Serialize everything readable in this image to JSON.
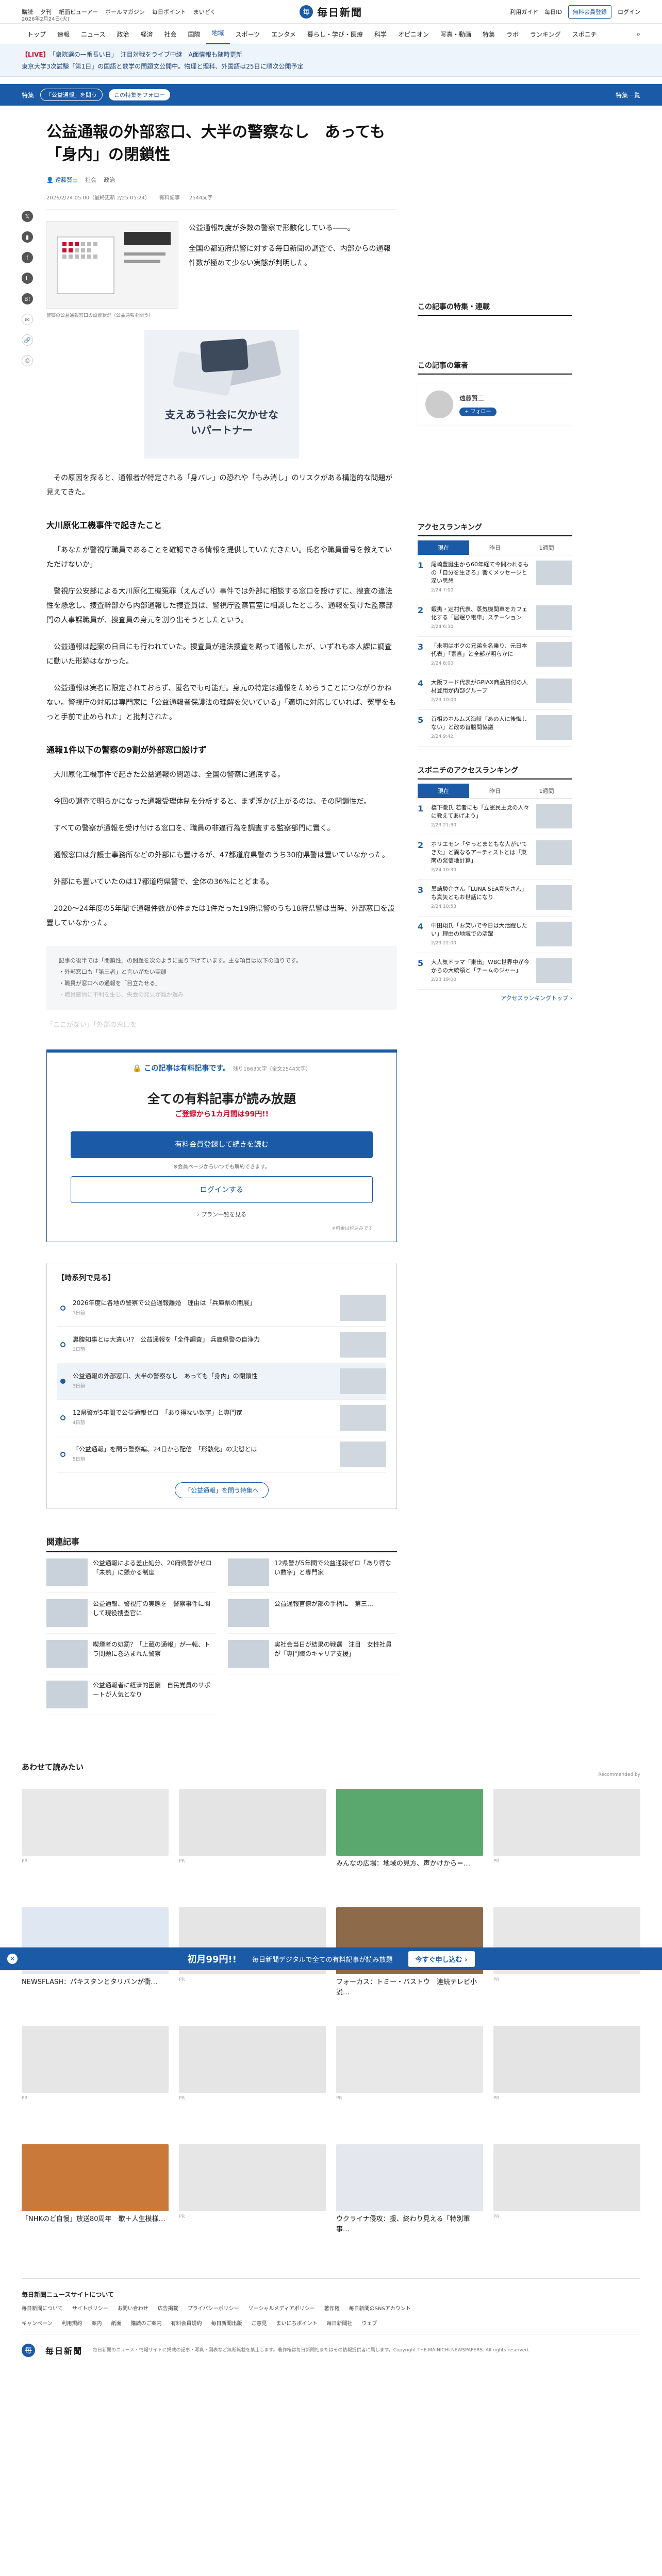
{
  "util": {
    "links": [
      "購読",
      "夕刊",
      "紙面ビューアー",
      "ポールマガジン",
      "毎日ポイント",
      "まいどく"
    ],
    "date": "2026年2月24日(火)",
    "right": [
      "利用ガイド",
      "毎日ID",
      "ログイン"
    ],
    "register": "無料会員登録",
    "login": "ログイン"
  },
  "logo": {
    "text": "毎日新聞"
  },
  "gnav": [
    "トップ",
    "速報",
    "ニュース",
    "政治",
    "経済",
    "社会",
    "国際",
    "地域",
    "スポーツ",
    "エンタメ",
    "暮らし・学び・医療",
    "科学",
    "オピニオン",
    "写真・動画",
    "特集",
    "ラボ",
    "ランキング",
    "スポニチ"
  ],
  "breaking": [
    {
      "tag": "【LIVE】",
      "text": "「衆院選の一番長い日」　注目対戦をライブ中継　A面情報も随時更新"
    },
    {
      "tag": "",
      "text": "東京大学3次試験「第1日」の国語と数学の問題文公開中。物理と理科、外国語は25日に順次公開予定"
    }
  ],
  "theme": {
    "label": "特集",
    "name": "「公益通報」を問う",
    "follow": "この特集をフォロー",
    "right": "特集一覧"
  },
  "article": {
    "title": "公益通報の外部窓口、大半の警察なし　あっても「身内」の閉鎖性",
    "author": "遠藤賢三",
    "tags": [
      "社会",
      "政治"
    ],
    "date": "2026/2/24 05:00（最終更新 2/25 05:24）",
    "paid": "有料記事",
    "chars": "2544文字",
    "fig1_caption": "警察の公益通報窓口の設置状況（公益通報を問う）",
    "lead": [
      "公益通報制度が多数の警察で形骸化している――。",
      "全国の都道府県警に対する毎日新聞の調査で、内部からの通報件数が極めて少ない実態が判明した。"
    ],
    "fig2_text": "支えあう社会に欠かせないパートナー",
    "paras": [
      "その原因を探ると、通報者が特定される「身バレ」の恐れや「もみ消し」のリスクがある構造的な問題が見えてきた。",
      "「あなたが警視庁職員であることを確認できる情報を提供していただきたい。氏名や職員番号を教えていただけないか」",
      "警視庁公安部による大川原化工機冤罪（えんざい）事件では外部に相談する窓口を設けずに、捜査の違法性を懸念し、捜査幹部から内部通報した捜査員は、警視庁監察官室に相談したところ、通報を受けた監察部門の人事課職員が、捜査員の身元を割り出そうとしたという。",
      "公益通報は起案の日目にも行われていた。捜査員が違法捜査を黙って通報したが、いずれも本人課に調査に動いた形跡はなかった。",
      "公益通報は実名に限定されておらず、匿名でも可能だ。身元の特定は通報をためらうことにつながりかねない。警視庁の対応は専門家に「公益通報者保護法の理解を欠いている」「適切に対応していれば、冤罪をもっと手前で止められた」と批判された。",
      "大川原化工機事件で起きた公益通報の問題は、全国の警察に通底する。",
      "今回の調査で明らかになった通報受理体制を分析すると、まず浮かび上がるのは、その閉鎖性だ。",
      "すべての警察が通報を受け付ける窓口を、職員の非違行為を調査する監察部門に置く。",
      "通報窓口は弁護士事務所などの外部にも置けるが、47都道府県警のうち30府県警は置いていなかった。",
      "外部にも置いていたのは17都道府県警で、全体の36%にとどまる。",
      "2020〜24年度の5年間で通報件数が0件または1件だった19府県警のうち18府県警は当時、外部窓口を設置していなかった。"
    ],
    "h2_1": "大川原化工機事件で起きたこと",
    "h2_2": "通報1件以下の警察の9割が外部窓口設けず",
    "notice": [
      "記事の後半では「閉鎖性」の問題を次のように掘り下げています。主な項目は以下の通りです。",
      "・外部窓口も「第三者」と言いがたい実態",
      "・職員が窓口への通報を「目立たせる」",
      "・職員感情に不利を生じ、失会の発見が難か遅み"
    ],
    "fade": "「ここがない」「外部の窓口を"
  },
  "paywall": {
    "head": "この記事は有料記事です。",
    "remain": "残り1663文字（全文2544文字）",
    "big": "全ての有料記事が読み放題",
    "sub": "ご登録から1カ月間は99円!!",
    "btn": "有料会員登録して続きを読む",
    "note": "※会員ページからいつでも解約できます。",
    "login": "ログインする",
    "plan": "› プラン一覧を見る",
    "foot": "※料金は税込みです"
  },
  "timeline": {
    "head": "【時系列で見る】",
    "items": [
      {
        "t": "2026年度に各地の警察で公益通報離婚　理由は「兵庫県の闇展」",
        "d": "1日前"
      },
      {
        "t": "裏腹知事とは大違い!?　公益通報を「全件調査」 兵庫県警の自浄力",
        "d": "3日前"
      },
      {
        "t": "公益通報の外部窓口、大半の警察なし　あっても「身内」の閉鎖性",
        "d": "3日前"
      },
      {
        "t": "12県警が5年間で公益通報ゼロ　「あり得ない数字」と専門家",
        "d": "4日前"
      },
      {
        "t": "「公益通報」を問う警察編、24日から配信　「形骸化」の実態とは",
        "d": "5日前"
      }
    ],
    "more": "「公益通報」を問う特集へ"
  },
  "related": {
    "head": "関連記事",
    "items": [
      {
        "t": "公益通報による差止処分、20府県警がゼロ「未熟」に懸かる制度",
        "d": ""
      },
      {
        "t": "12県警が5年間で公益通報ゼロ「あり得ない数字」と専門家",
        "d": ""
      },
      {
        "t": "公益通報、警視庁の実態を　警察事件に関して現役捜査官に",
        "d": ""
      },
      {
        "t": "公益通報官僚が部の手柄に　第三…",
        "d": ""
      },
      {
        "t": "喫煙者の処罰？「上蔵の通報」が一転、トラ問題に巻込まれた警察",
        "d": ""
      },
      {
        "t": "実社会当日が結果の戦選　注目　女性社員が「専門職のキャリア支援」",
        "d": ""
      },
      {
        "t": "公益通報者に経済的困窮　自民党員のサポートが人気となり",
        "d": ""
      }
    ]
  },
  "side": {
    "follow_head": "この記事の特集・連載",
    "author_head": "この記事の筆者",
    "author_name": "遠藤賢三",
    "author_follow": "+ フォロー",
    "rank_head": "アクセスランキング",
    "rank_tabs": [
      "現在",
      "昨日",
      "1週間"
    ],
    "rank": [
      {
        "t": "尾崎豊誕生から60年経て今問われるもの「自分を生きろ」響くメッセージと深い思想",
        "d": "2/24 7:00"
      },
      {
        "t": "蝦夷・定村代表、蒸気機関車をカフェ化する「居眠り電車」ステーション",
        "d": "2/24 6:30"
      },
      {
        "t": "「未明はボクの兄弟を名乗り、元日本代表」「素直」と全部が明らかに",
        "d": "2/24 8:00"
      },
      {
        "t": "大阪フード代表がGPIAX商品貸付の人材登用が内部グループ",
        "d": "2/23 10:00"
      },
      {
        "t": "首相のホルムズ海峡「あの人に後悔しない」と改め首脳間協議",
        "d": "2/24 9:42"
      }
    ],
    "sponichi_head": "スポニチのアクセスランキング",
    "sponichi_tabs": [
      "現在",
      "昨日",
      "1週間"
    ],
    "sponichi": [
      {
        "t": "橋下徹氏 若者にも「立憲民主党の人々に教えてあげよう」",
        "d": "2/23 21:30"
      },
      {
        "t": "ホリエモン「やっとまともな人がいてきた」と異なるアーティストとは「東南の発信地計算」",
        "d": "2/24 10:30"
      },
      {
        "t": "黒崎駿介さん「LUNA SEA真矢さん」も真矢ともお世話になり",
        "d": "2/24 10:53"
      },
      {
        "t": "中田翔氏「お笑いで今日は大活躍したい」理由の地域での活躍",
        "d": "2/23 22:00"
      },
      {
        "t": "大人気ドラマ「東出」WBC世界中が今からの大統領と「チームのジャー」",
        "d": "2/23 19:00"
      }
    ],
    "sponichi_more": "アクセスランキングトップ ›"
  },
  "banner": {
    "b1": "初月99円!!",
    "b2": "毎日新聞デジタルで全ての有料記事が読み放題",
    "cta": "今すぐ申し込む ›",
    "close": "✕"
  },
  "recommend": {
    "head": "あわせて読みたい",
    "by": "Recommended by",
    "cards": [
      {
        "t": "",
        "s": "PR"
      },
      {
        "t": "",
        "s": "PR"
      },
      {
        "t": "みんなの広場：地域の見方、声かけから＝…",
        "s": ""
      },
      {
        "t": "",
        "s": "PR"
      },
      {
        "t": "NEWSFLASH：パキスタンとタリバンが衝…",
        "s": ""
      },
      {
        "t": "",
        "s": "PR"
      },
      {
        "t": "フォーカス：トミー・バストウ　連続テレビ小説…",
        "s": ""
      },
      {
        "t": "",
        "s": "PR"
      },
      {
        "t": "",
        "s": "PR"
      },
      {
        "t": "",
        "s": "PR"
      },
      {
        "t": "",
        "s": "PR"
      },
      {
        "t": "",
        "s": "PR"
      },
      {
        "t": "「NHKのど自慢」放送80周年　歌＋人生模様…",
        "s": ""
      },
      {
        "t": "",
        "s": "PR"
      },
      {
        "t": "ウクライナ侵攻：援、終わり見える「特別軍事…",
        "s": ""
      },
      {
        "t": "",
        "s": "PR"
      }
    ]
  },
  "footer": {
    "head": "毎日新聞ニュースサイトについて",
    "row1": [
      "毎日新聞について",
      "サイトポリシー",
      "お問い合わせ",
      "広告掲載",
      "プライバシーポリシー",
      "ソーシャルメディアポリシー",
      "著作権",
      "毎日新聞のSNSアカウント"
    ],
    "row2": [
      "キャンペーン",
      "利用規約",
      "案内",
      "紙面",
      "購読のご案内",
      "有料会員規約",
      "毎日新聞出版",
      "ご意見",
      "まいにちポイント",
      "毎日新聞社",
      "ウェブ"
    ],
    "copy": "毎日新聞のニュース・情報サイトに掲載の記事・写真・図表など無断転載を禁止します。著作権は毎日新聞社またはその情報提供者に属します。Copyright THE MAINICHI NEWSPAPERS. All rights reserved."
  }
}
